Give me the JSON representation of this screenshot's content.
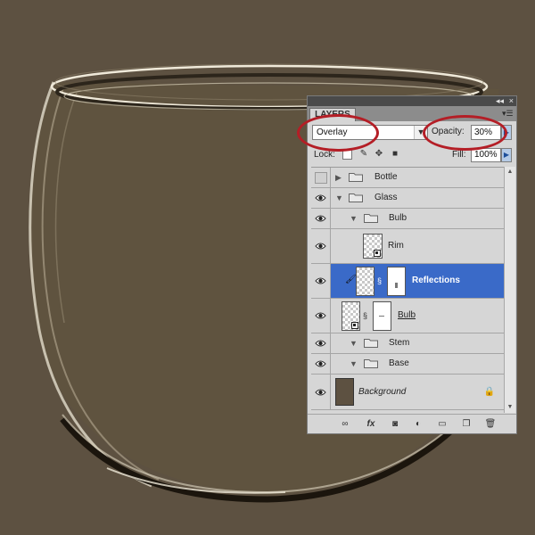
{
  "panel": {
    "tab_label": "LAYERS",
    "collapse_arrows": "◂◂",
    "close": "×",
    "menu_icon": "panel-menu-icon"
  },
  "blend": {
    "mode": "Overlay",
    "opacity_label": "Opacity:",
    "opacity_value": "30%",
    "lock_label": "Lock:",
    "fill_label": "Fill:",
    "fill_value": "100%"
  },
  "layers": [
    {
      "name": "Bottle",
      "type": "group",
      "visible": false,
      "expanded": false
    },
    {
      "name": "Glass",
      "type": "group",
      "visible": true,
      "expanded": true
    },
    {
      "name": "Bulb",
      "type": "group",
      "visible": true,
      "expanded": true
    },
    {
      "name": "Rim",
      "type": "smart-object",
      "visible": true
    },
    {
      "name": "Reflections",
      "type": "layer-with-mask",
      "visible": true,
      "selected": true
    },
    {
      "name": "Bulb",
      "type": "smart-object-with-mask",
      "visible": true
    },
    {
      "name": "Stem",
      "type": "group",
      "visible": true,
      "expanded": true
    },
    {
      "name": "Base",
      "type": "group",
      "visible": true,
      "expanded": true
    },
    {
      "name": "Background",
      "type": "background",
      "visible": true,
      "locked": true
    }
  ],
  "colors": {
    "canvas_background": "#5d5141",
    "selected_row": "#3a6ac8",
    "highlight_ring": "#b41e26",
    "background_layer_swatch": "#5d5141"
  },
  "bottom_icons": [
    "link-layers-icon",
    "fx-icon",
    "add-mask-icon",
    "adjustment-layer-icon",
    "new-group-icon",
    "new-layer-icon",
    "trash-icon"
  ]
}
